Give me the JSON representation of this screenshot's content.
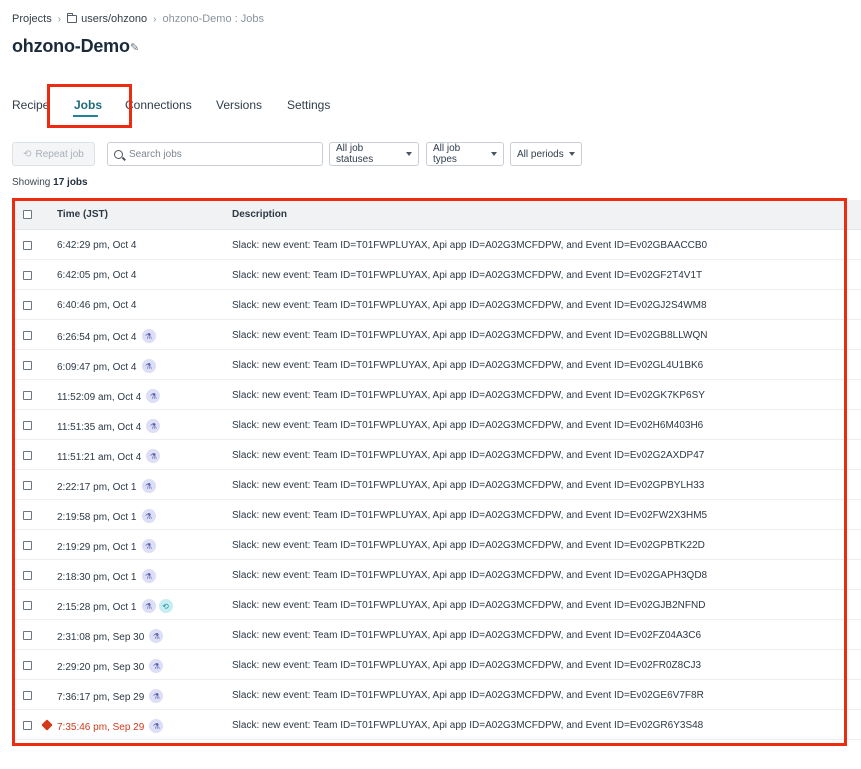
{
  "breadcrumb": {
    "projects": "Projects",
    "folder": "users/ohzono",
    "current": "ohzono-Demo : Jobs"
  },
  "page": {
    "title": "ohzono-Demo"
  },
  "tabs": [
    {
      "label": "Recipe",
      "active": false
    },
    {
      "label": "Jobs",
      "active": true
    },
    {
      "label": "Connections",
      "active": false
    },
    {
      "label": "Versions",
      "active": false
    },
    {
      "label": "Settings",
      "active": false
    }
  ],
  "toolbar": {
    "repeat_label": "Repeat job",
    "search_placeholder": "Search jobs",
    "status_filter": "All job statuses",
    "type_filter": "All job types",
    "period_filter": "All periods"
  },
  "summary": {
    "prefix": "Showing ",
    "count": "17 jobs"
  },
  "table": {
    "headers": {
      "time": "Time (JST)",
      "description": "Description"
    },
    "rows": [
      {
        "time": "6:42:29 pm, Oct 4",
        "desc": "Slack: new event: Team ID=T01FWPLUYAX, Api app ID=A02G3MCFDPW, and Event ID=Ev02GBAACCB0",
        "test": false,
        "repeat": false,
        "error": false
      },
      {
        "time": "6:42:05 pm, Oct 4",
        "desc": "Slack: new event: Team ID=T01FWPLUYAX, Api app ID=A02G3MCFDPW, and Event ID=Ev02GF2T4V1T",
        "test": false,
        "repeat": false,
        "error": false
      },
      {
        "time": "6:40:46 pm, Oct 4",
        "desc": "Slack: new event: Team ID=T01FWPLUYAX, Api app ID=A02G3MCFDPW, and Event ID=Ev02GJ2S4WM8",
        "test": false,
        "repeat": false,
        "error": false
      },
      {
        "time": "6:26:54 pm, Oct 4",
        "desc": "Slack: new event: Team ID=T01FWPLUYAX, Api app ID=A02G3MCFDPW, and Event ID=Ev02GB8LLWQN",
        "test": true,
        "repeat": false,
        "error": false
      },
      {
        "time": "6:09:47 pm, Oct 4",
        "desc": "Slack: new event: Team ID=T01FWPLUYAX, Api app ID=A02G3MCFDPW, and Event ID=Ev02GL4U1BK6",
        "test": true,
        "repeat": false,
        "error": false
      },
      {
        "time": "11:52:09 am, Oct 4",
        "desc": "Slack: new event: Team ID=T01FWPLUYAX, Api app ID=A02G3MCFDPW, and Event ID=Ev02GK7KP6SY",
        "test": true,
        "repeat": false,
        "error": false
      },
      {
        "time": "11:51:35 am, Oct 4",
        "desc": "Slack: new event: Team ID=T01FWPLUYAX, Api app ID=A02G3MCFDPW, and Event ID=Ev02H6M403H6",
        "test": true,
        "repeat": false,
        "error": false
      },
      {
        "time": "11:51:21 am, Oct 4",
        "desc": "Slack: new event: Team ID=T01FWPLUYAX, Api app ID=A02G3MCFDPW, and Event ID=Ev02G2AXDP47",
        "test": true,
        "repeat": false,
        "error": false
      },
      {
        "time": "2:22:17 pm, Oct 1",
        "desc": "Slack: new event: Team ID=T01FWPLUYAX, Api app ID=A02G3MCFDPW, and Event ID=Ev02GPBYLH33",
        "test": true,
        "repeat": false,
        "error": false
      },
      {
        "time": "2:19:58 pm, Oct 1",
        "desc": "Slack: new event: Team ID=T01FWPLUYAX, Api app ID=A02G3MCFDPW, and Event ID=Ev02FW2X3HM5",
        "test": true,
        "repeat": false,
        "error": false
      },
      {
        "time": "2:19:29 pm, Oct 1",
        "desc": "Slack: new event: Team ID=T01FWPLUYAX, Api app ID=A02G3MCFDPW, and Event ID=Ev02GPBTK22D",
        "test": true,
        "repeat": false,
        "error": false
      },
      {
        "time": "2:18:30 pm, Oct 1",
        "desc": "Slack: new event: Team ID=T01FWPLUYAX, Api app ID=A02G3MCFDPW, and Event ID=Ev02GAPH3QD8",
        "test": true,
        "repeat": false,
        "error": false
      },
      {
        "time": "2:15:28 pm, Oct 1",
        "desc": "Slack: new event: Team ID=T01FWPLUYAX, Api app ID=A02G3MCFDPW, and Event ID=Ev02GJB2NFND",
        "test": true,
        "repeat": true,
        "error": false
      },
      {
        "time": "2:31:08 pm, Sep 30",
        "desc": "Slack: new event: Team ID=T01FWPLUYAX, Api app ID=A02G3MCFDPW, and Event ID=Ev02FZ04A3C6",
        "test": true,
        "repeat": false,
        "error": false
      },
      {
        "time": "2:29:20 pm, Sep 30",
        "desc": "Slack: new event: Team ID=T01FWPLUYAX, Api app ID=A02G3MCFDPW, and Event ID=Ev02FR0Z8CJ3",
        "test": true,
        "repeat": false,
        "error": false
      },
      {
        "time": "7:36:17 pm, Sep 29",
        "desc": "Slack: new event: Team ID=T01FWPLUYAX, Api app ID=A02G3MCFDPW, and Event ID=Ev02GE6V7F8R",
        "test": true,
        "repeat": false,
        "error": false
      },
      {
        "time": "7:35:46 pm, Sep 29",
        "desc": "Slack: new event: Team ID=T01FWPLUYAX, Api app ID=A02G3MCFDPW, and Event ID=Ev02GR6Y3S48",
        "test": true,
        "repeat": false,
        "error": true
      }
    ]
  },
  "colors": {
    "accent": "#1d8599",
    "highlight": "#ee2a10",
    "error": "#d23a1a"
  },
  "icons": {
    "test": "flask-icon",
    "repeat": "repeat-icon",
    "error": "error-diamond-icon"
  }
}
